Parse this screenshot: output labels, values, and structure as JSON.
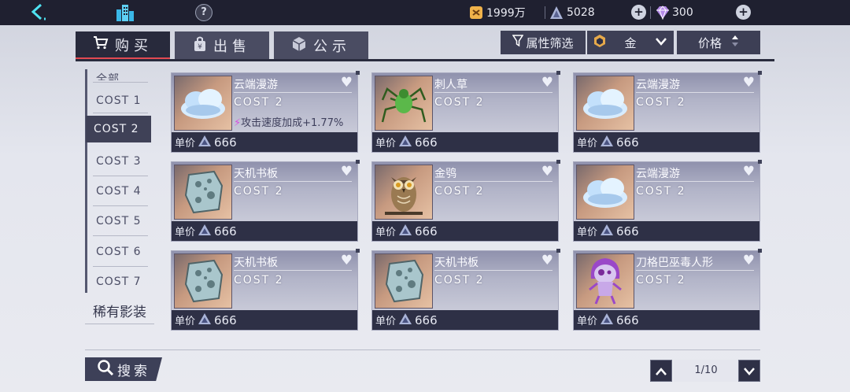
{
  "topbar": {
    "gold_amount": "1999万",
    "crystal_amount": "5028",
    "gem_amount": "300"
  },
  "tabs": [
    {
      "label": "购买",
      "icon": "cart-icon"
    },
    {
      "label": "出售",
      "icon": "bag-yen-icon"
    },
    {
      "label": "公示",
      "icon": "cube-icon"
    }
  ],
  "filters": {
    "attribute_filter": "属性筛选",
    "quality": "金",
    "sort": "价格"
  },
  "sidebar": {
    "partial_top": "全部",
    "items": [
      "COST 1",
      "COST 2",
      "COST 3",
      "COST 4",
      "COST 5",
      "COST 6",
      "COST 7"
    ],
    "rare": "稀有影装"
  },
  "price_label": "单价",
  "cards": [
    {
      "name": "云端漫游",
      "cost": "COST 2",
      "bonus": "攻击速度加成+1.77%",
      "price": "666",
      "image": "cloud"
    },
    {
      "name": "刺人草",
      "cost": "COST 2",
      "bonus": "",
      "price": "666",
      "image": "spider"
    },
    {
      "name": "云端漫游",
      "cost": "COST 2",
      "bonus": "",
      "price": "666",
      "image": "cloud"
    },
    {
      "name": "天机书板",
      "cost": "COST 2",
      "bonus": "",
      "price": "666",
      "image": "stone"
    },
    {
      "name": "金鸮",
      "cost": "COST 2",
      "bonus": "",
      "price": "666",
      "image": "owl"
    },
    {
      "name": "云端漫游",
      "cost": "COST 2",
      "bonus": "",
      "price": "666",
      "image": "cloud"
    },
    {
      "name": "天机书板",
      "cost": "COST 2",
      "bonus": "",
      "price": "666",
      "image": "stone"
    },
    {
      "name": "天机书板",
      "cost": "COST 2",
      "bonus": "",
      "price": "666",
      "image": "stone"
    },
    {
      "name": "刀格巴巫毒人形",
      "cost": "COST 2",
      "bonus": "",
      "price": "666",
      "image": "doll"
    }
  ],
  "search": {
    "label": "搜索"
  },
  "pagination": {
    "page": "1/10"
  }
}
